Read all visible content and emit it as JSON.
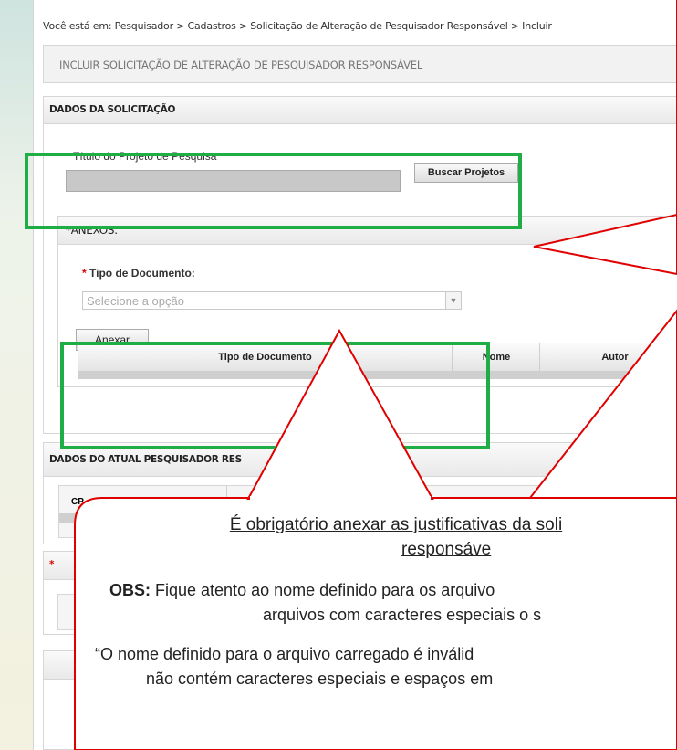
{
  "breadcrumb": "Você está em: Pesquisador > Cadastros > Solicitação de Alteração de Pesquisador Responsável > Incluir",
  "page_title": "INCLUIR SOLICITAÇÃO DE ALTERAÇÃO DE PESQUISADOR RESPONSÁVEL",
  "sections": {
    "dados_solicitacao": "DADOS DA SOLICITAÇÃO",
    "titulo_label": "Título do Projeto de Pesquisa",
    "buscar_label": "Buscar Projetos",
    "anexos": "*ANEXOS:",
    "tipo_documento_label": "Tipo de Documento:",
    "select_placeholder": "Selecione a opção",
    "anexar_label": "Anexar",
    "grid_headers": [
      "Tipo de Documento",
      "Nome",
      "Autor"
    ],
    "dados_atual": "DADOS DO ATUAL PESQUISADOR RES",
    "cpf_fragment": "CP",
    "req_star": "*"
  },
  "callout": {
    "line1": "É obrigatório anexar as justificativas da soli",
    "line2": "responsáve",
    "obs_label": "OBS:",
    "obs_text": " Fique atento ao nome definido para os arquivo",
    "obs_line2": "arquivos com caracteres especiais o s",
    "quote_line1": "“O nome definido para o arquivo carregado é inválid",
    "quote_line2": "não contém caracteres especiais e espaços em"
  },
  "colors": {
    "highlight_green": "#1fae45",
    "callout_red": "#e00000"
  }
}
